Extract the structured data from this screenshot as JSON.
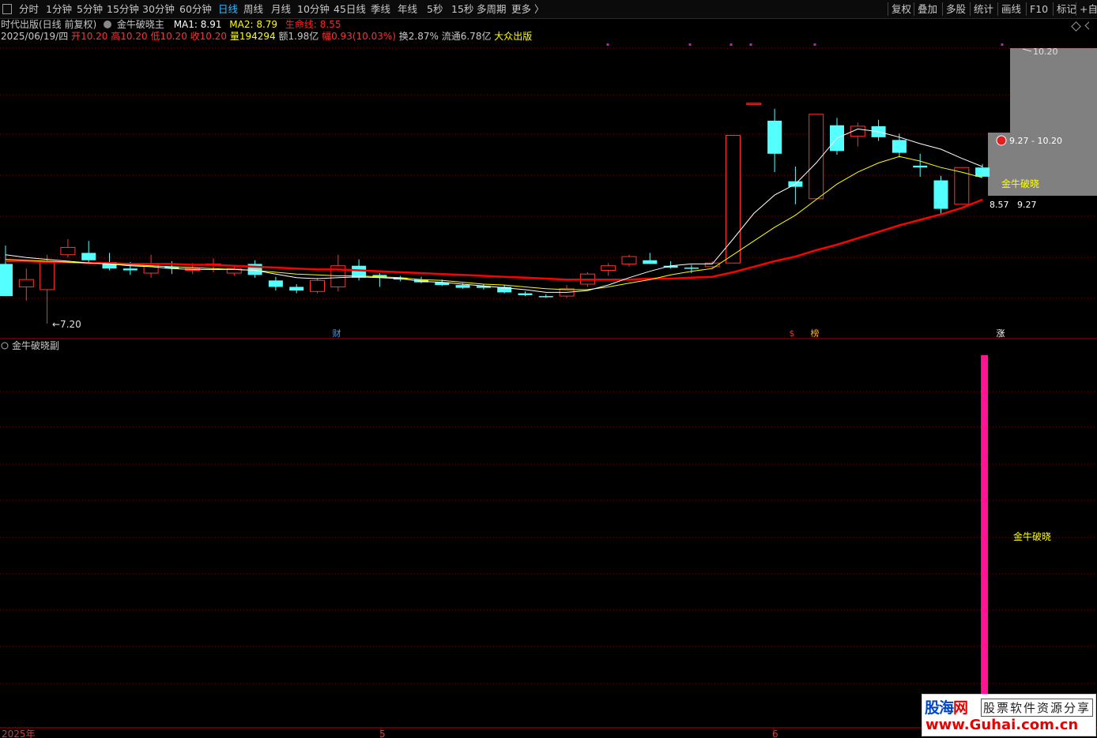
{
  "toolbar": {
    "periods": [
      "分时",
      "1分钟",
      "5分钟",
      "15分钟",
      "30分钟",
      "60分钟",
      "日线",
      "周线",
      "月线",
      "10分钟",
      "45日线",
      "季线",
      "年线",
      "5秒",
      "15秒",
      "多周期",
      "更多 〉"
    ],
    "active_period": "日线",
    "right_buttons": [
      "复权",
      "叠加",
      "多股",
      "统计",
      "画线",
      "F10",
      "标记",
      "+自"
    ]
  },
  "header": {
    "stock_title": "时代出版(日线 前复权)",
    "indicator_name": "金牛破晓主",
    "ma1_label": "MA1: 8.91",
    "ma2_label": "MA2: 8.79",
    "life_label": "生命线: 8.55"
  },
  "quote": {
    "date": "2025/06/19/四",
    "open_label": "开",
    "open": "10.20",
    "high_label": "高",
    "high": "10.20",
    "low_label": "低",
    "low": "10.20",
    "close_label": "收",
    "close": "10.20",
    "vol_label": "量",
    "vol": "194294",
    "amt_label": "额",
    "amt": "1.98亿",
    "chg_label": "幅",
    "chg": "0.93(10.03%)",
    "turn": "换2.87%",
    "float": "流通6.78亿",
    "concept": "大众出版"
  },
  "colors": {
    "up": "#ff3232",
    "down": "#54ffff",
    "ma1": "#ffffff",
    "ma2": "#ffff00",
    "life": "#ff0000",
    "grid": "#8b0000",
    "bar": "#ff1493",
    "label_yellow": "#ffff00"
  },
  "main_chart": {
    "high_label": "10.20",
    "low_label": "7.20",
    "range_label": "9.27 - 10.20",
    "signal_label": "金牛破晓",
    "right_price_left": "8.57",
    "right_price_right": "9.27",
    "event_marks": [
      "财",
      "$",
      "榜",
      "涨"
    ]
  },
  "sub_chart": {
    "title": "金牛破晓副",
    "signal_label": "金牛破晓"
  },
  "time_axis": {
    "labels": [
      "2025年",
      "5",
      "6"
    ]
  },
  "watermark": {
    "brand_a": "股海",
    "brand_b": "网",
    "tagline": "股票软件资源分享",
    "url": "www.Guhai.com.cn"
  },
  "chart_data": {
    "type": "candlestick",
    "ylim": [
      7.0,
      10.5
    ],
    "candles": [
      {
        "o": 7.85,
        "h": 8.05,
        "l": 7.5,
        "c": 7.5
      },
      {
        "o": 7.6,
        "h": 7.8,
        "l": 7.45,
        "c": 7.68
      },
      {
        "o": 7.57,
        "h": 7.95,
        "l": 7.2,
        "c": 7.87
      },
      {
        "o": 7.95,
        "h": 8.12,
        "l": 7.92,
        "c": 8.03
      },
      {
        "o": 7.97,
        "h": 8.1,
        "l": 7.85,
        "c": 7.89
      },
      {
        "o": 7.87,
        "h": 7.97,
        "l": 7.78,
        "c": 7.8
      },
      {
        "o": 7.8,
        "h": 7.87,
        "l": 7.73,
        "c": 7.78
      },
      {
        "o": 7.75,
        "h": 7.95,
        "l": 7.7,
        "c": 7.85
      },
      {
        "o": 7.82,
        "h": 7.88,
        "l": 7.74,
        "c": 7.8
      },
      {
        "o": 7.78,
        "h": 7.86,
        "l": 7.74,
        "c": 7.8
      },
      {
        "o": 7.85,
        "h": 7.91,
        "l": 7.76,
        "c": 7.85
      },
      {
        "o": 7.75,
        "h": 7.84,
        "l": 7.72,
        "c": 7.8
      },
      {
        "o": 7.85,
        "h": 7.89,
        "l": 7.7,
        "c": 7.73
      },
      {
        "o": 7.67,
        "h": 7.71,
        "l": 7.56,
        "c": 7.6
      },
      {
        "o": 7.6,
        "h": 7.63,
        "l": 7.53,
        "c": 7.56
      },
      {
        "o": 7.55,
        "h": 7.7,
        "l": 7.53,
        "c": 7.67
      },
      {
        "o": 7.6,
        "h": 7.95,
        "l": 7.55,
        "c": 7.83
      },
      {
        "o": 7.83,
        "h": 7.9,
        "l": 7.67,
        "c": 7.7
      },
      {
        "o": 7.73,
        "h": 7.75,
        "l": 7.6,
        "c": 7.7
      },
      {
        "o": 7.7,
        "h": 7.72,
        "l": 7.66,
        "c": 7.68
      },
      {
        "o": 7.68,
        "h": 7.71,
        "l": 7.64,
        "c": 7.65
      },
      {
        "o": 7.65,
        "h": 7.68,
        "l": 7.61,
        "c": 7.62
      },
      {
        "o": 7.62,
        "h": 7.64,
        "l": 7.58,
        "c": 7.59
      },
      {
        "o": 7.61,
        "h": 7.63,
        "l": 7.57,
        "c": 7.59
      },
      {
        "o": 7.6,
        "h": 7.62,
        "l": 7.53,
        "c": 7.54
      },
      {
        "o": 7.53,
        "h": 7.55,
        "l": 7.5,
        "c": 7.51
      },
      {
        "o": 7.5,
        "h": 7.52,
        "l": 7.48,
        "c": 7.49
      },
      {
        "o": 7.5,
        "h": 7.62,
        "l": 7.48,
        "c": 7.58
      },
      {
        "o": 7.63,
        "h": 7.76,
        "l": 7.6,
        "c": 7.74
      },
      {
        "o": 7.78,
        "h": 7.86,
        "l": 7.72,
        "c": 7.83
      },
      {
        "o": 7.85,
        "h": 7.95,
        "l": 7.82,
        "c": 7.93
      },
      {
        "o": 7.89,
        "h": 7.97,
        "l": 7.85,
        "c": 7.85
      },
      {
        "o": 7.83,
        "h": 7.88,
        "l": 7.8,
        "c": 7.81
      },
      {
        "o": 7.81,
        "h": 7.84,
        "l": 7.75,
        "c": 7.8
      },
      {
        "o": 7.82,
        "h": 7.88,
        "l": 7.8,
        "c": 7.86
      },
      {
        "o": 7.86,
        "h": 9.25,
        "l": 7.86,
        "c": 9.25
      },
      {
        "o": 9.6,
        "h": 9.6,
        "l": 9.6,
        "c": 9.6
      },
      {
        "o": 9.41,
        "h": 9.54,
        "l": 8.85,
        "c": 9.05
      },
      {
        "o": 8.75,
        "h": 8.91,
        "l": 8.5,
        "c": 8.69
      },
      {
        "o": 8.56,
        "h": 9.48,
        "l": 8.56,
        "c": 9.48
      },
      {
        "o": 9.36,
        "h": 9.44,
        "l": 9.04,
        "c": 9.08
      },
      {
        "o": 9.24,
        "h": 9.39,
        "l": 9.13,
        "c": 9.35
      },
      {
        "o": 9.35,
        "h": 9.42,
        "l": 9.19,
        "c": 9.23
      },
      {
        "o": 9.2,
        "h": 9.27,
        "l": 9.01,
        "c": 9.06
      },
      {
        "o": 8.92,
        "h": 9.05,
        "l": 8.8,
        "c": 8.9
      },
      {
        "o": 8.76,
        "h": 8.81,
        "l": 8.4,
        "c": 8.45
      },
      {
        "o": 8.5,
        "h": 8.9,
        "l": 8.5,
        "c": 8.9
      },
      {
        "o": 8.9,
        "h": 8.94,
        "l": 8.8,
        "c": 8.8
      }
    ],
    "ma1": [
      7.95,
      7.92,
      7.9,
      7.88,
      7.86,
      7.85,
      7.83,
      7.82,
      7.8,
      7.79,
      7.79,
      7.79,
      7.78,
      7.74,
      7.7,
      7.69,
      7.7,
      7.71,
      7.7,
      7.69,
      7.66,
      7.65,
      7.63,
      7.61,
      7.59,
      7.57,
      7.54,
      7.54,
      7.56,
      7.62,
      7.7,
      7.77,
      7.83,
      7.85,
      7.85,
      8.12,
      8.4,
      8.6,
      8.72,
      8.95,
      9.22,
      9.32,
      9.29,
      9.23,
      9.16,
      9.1,
      9.0,
      8.91
    ],
    "ma2": [
      7.9,
      7.89,
      7.88,
      7.87,
      7.86,
      7.85,
      7.84,
      7.83,
      7.82,
      7.81,
      7.8,
      7.79,
      7.78,
      7.76,
      7.74,
      7.73,
      7.72,
      7.72,
      7.71,
      7.7,
      7.68,
      7.67,
      7.65,
      7.63,
      7.62,
      7.6,
      7.58,
      7.57,
      7.57,
      7.6,
      7.64,
      7.68,
      7.73,
      7.77,
      7.8,
      7.95,
      8.1,
      8.25,
      8.38,
      8.55,
      8.72,
      8.85,
      8.95,
      9.02,
      8.97,
      8.9,
      8.85,
      8.79
    ],
    "life": [
      7.88,
      7.88,
      7.87,
      7.87,
      7.86,
      7.86,
      7.85,
      7.85,
      7.85,
      7.84,
      7.84,
      7.83,
      7.82,
      7.81,
      7.8,
      7.79,
      7.79,
      7.78,
      7.77,
      7.76,
      7.75,
      7.74,
      7.73,
      7.72,
      7.71,
      7.7,
      7.69,
      7.68,
      7.68,
      7.68,
      7.68,
      7.69,
      7.69,
      7.7,
      7.71,
      7.76,
      7.82,
      7.88,
      7.93,
      8.0,
      8.06,
      8.13,
      8.2,
      8.27,
      8.33,
      8.39,
      8.46,
      8.55
    ],
    "sub_series": [
      0,
      0,
      0,
      0,
      0,
      0,
      0,
      0,
      0,
      0,
      0,
      0,
      0,
      0,
      0,
      0,
      0,
      0,
      0,
      0,
      0,
      0,
      0,
      0,
      0,
      0,
      0,
      0,
      0,
      0,
      0,
      0,
      0,
      0,
      0,
      0,
      0,
      0,
      0,
      0,
      0,
      0,
      0,
      0,
      0,
      0,
      0,
      1
    ]
  }
}
